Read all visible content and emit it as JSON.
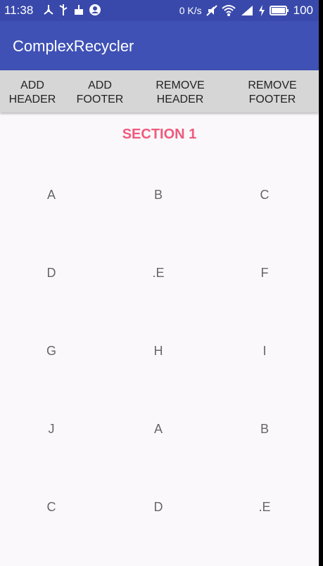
{
  "status_bar": {
    "time": "11:38",
    "data_rate": "0 K/s",
    "battery": "100",
    "icons": [
      "usb-debug-icon",
      "usb-icon",
      "cleaner-icon",
      "account-icon",
      "data-rate",
      "mute-icon",
      "wifi-icon",
      "signal-4g-icon",
      "charging-icon",
      "battery-icon"
    ]
  },
  "app_bar": {
    "title": "ComplexRecycler",
    "color": "#3f51b5"
  },
  "toolbar": {
    "buttons": [
      {
        "label": "ADD\nHEADER"
      },
      {
        "label": "ADD\nFOOTER"
      },
      {
        "label": "REMOVE\nHEADER"
      },
      {
        "label": "REMOVE\nFOOTER"
      }
    ]
  },
  "section": {
    "title": "SECTION 1",
    "color": "#ef5a7d"
  },
  "grid_items": [
    "A",
    "B",
    "C",
    "D",
    ".E",
    "F",
    "G",
    "H",
    "I",
    "J",
    "A",
    "B",
    "C",
    "D",
    ".E"
  ]
}
